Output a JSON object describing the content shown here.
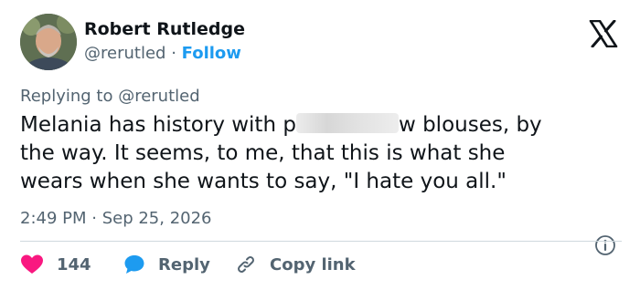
{
  "author": {
    "name": "Robert Rutledge",
    "handle": "@rerutled",
    "separator": "·",
    "follow_label": "Follow"
  },
  "reply_context": "Replying to @rerutled",
  "tweet": {
    "line1_before": "Melania has history with p",
    "line1_after": "w blouses, by",
    "line2": "the way.  It seems, to me, that this is what she",
    "line3": "wears when she wants to say, \"I hate you all.\""
  },
  "timestamp": "2:49 PM · Sep 25, 2026",
  "actions": {
    "like_count": "144",
    "reply_label": "Reply",
    "copy_link_label": "Copy link"
  },
  "icons": {
    "brand": "x-logo-icon",
    "like": "heart-icon",
    "reply": "speech-bubble-icon",
    "copy": "link-icon",
    "info": "info-icon"
  },
  "colors": {
    "accent": "#1d9bf0",
    "like": "#f91880",
    "text": "#0f1419",
    "muted": "#536471"
  }
}
